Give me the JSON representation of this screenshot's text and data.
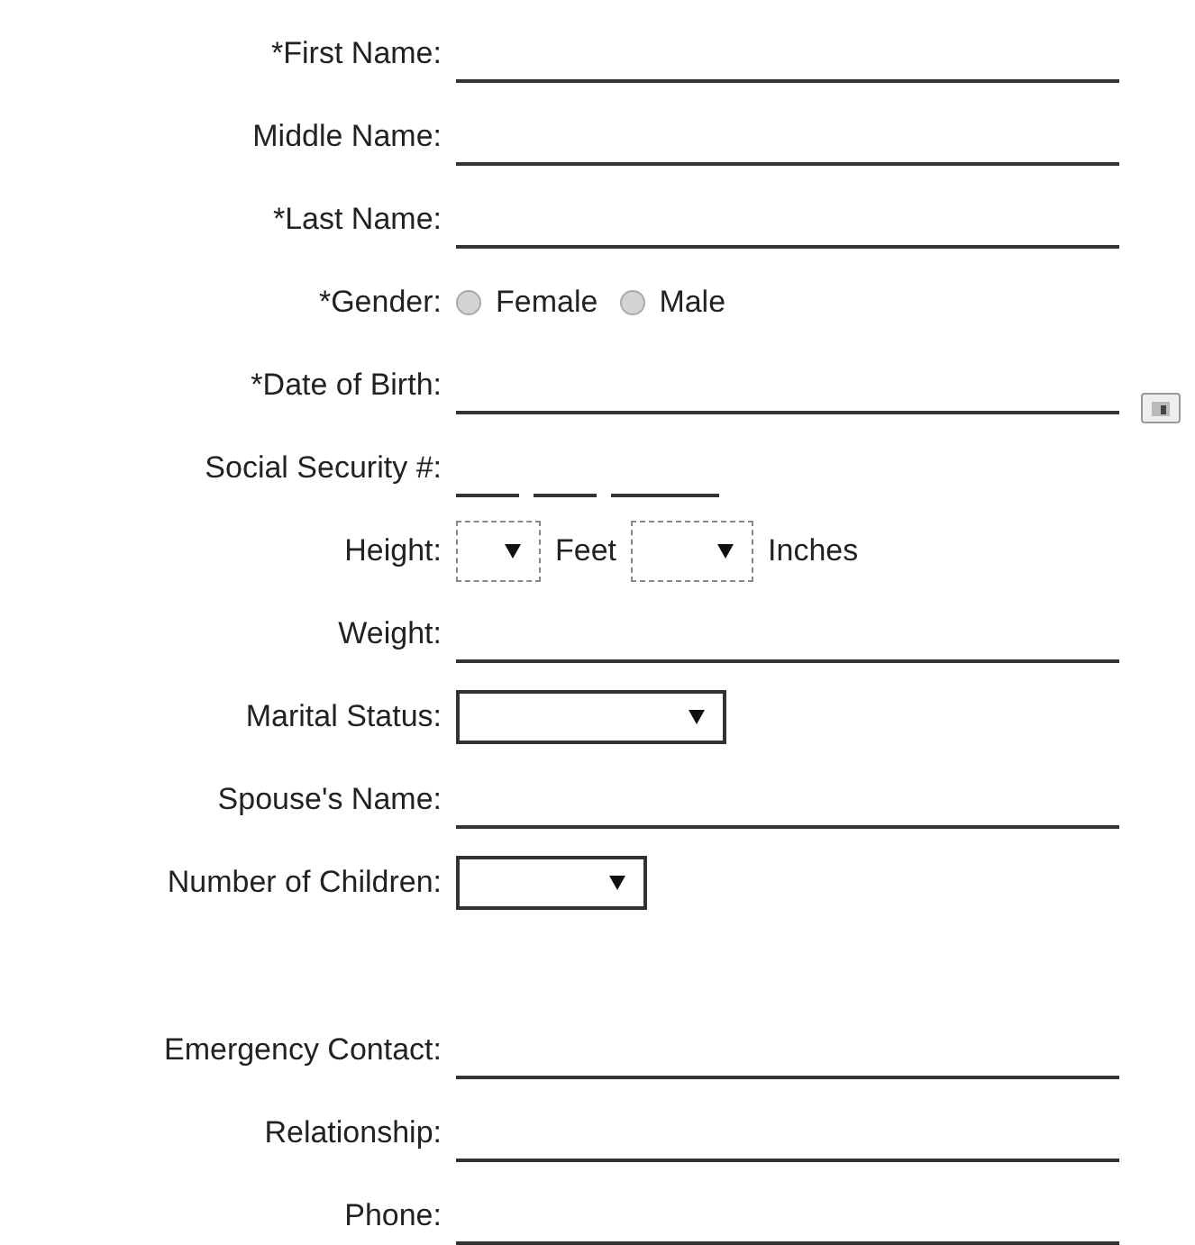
{
  "sections": [
    {
      "fields": [
        {
          "kind": "text",
          "label": "*First Name:"
        },
        {
          "kind": "text",
          "label": "Middle Name:"
        },
        {
          "kind": "text",
          "label": "*Last Name:"
        },
        {
          "kind": "radio",
          "label": "*Gender:",
          "options": [
            {
              "label": "Female",
              "selected": false
            },
            {
              "label": "Male",
              "selected": false
            }
          ]
        },
        {
          "kind": "date",
          "label": "*Date of Birth:"
        },
        {
          "kind": "ssn",
          "label": "Social Security #:"
        },
        {
          "kind": "height",
          "label": "Height:",
          "units": [
            "Feet",
            "Inches"
          ]
        },
        {
          "kind": "text",
          "label": "Weight:"
        },
        {
          "kind": "select",
          "label": "Marital Status:"
        },
        {
          "kind": "text",
          "label": "Spouse's Name:"
        },
        {
          "kind": "select",
          "label": "Number of Children:"
        }
      ]
    },
    {
      "fields": [
        {
          "kind": "text",
          "label": "Emergency Contact:"
        },
        {
          "kind": "text",
          "label": "Relationship:"
        },
        {
          "kind": "text",
          "label": "Phone:"
        }
      ]
    }
  ]
}
